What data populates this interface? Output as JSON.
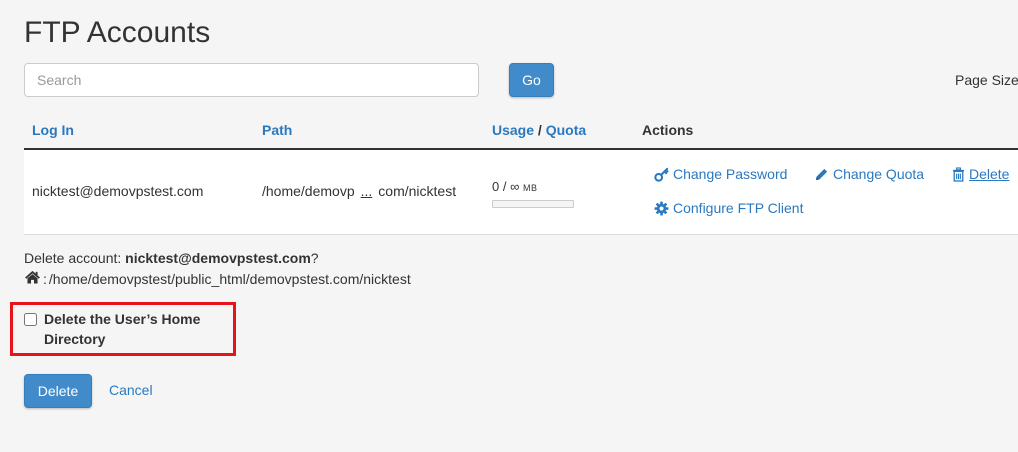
{
  "page": {
    "title": "FTP Accounts"
  },
  "search": {
    "placeholder": "Search",
    "value": "",
    "go_label": "Go",
    "page_size_label": "Page Size"
  },
  "table": {
    "headers": {
      "login": "Log In",
      "path": "Path",
      "usage": "Usage",
      "separator": "/",
      "quota": "Quota",
      "actions": "Actions"
    },
    "rows": [
      {
        "login": "nicktest@demovpstest.com",
        "path_start": "/home/demovp",
        "path_ellipsis": "...",
        "path_end": "com/nicktest",
        "usage_value": "0 / ∞",
        "usage_unit": "MB",
        "usage_fraction": 0,
        "actions": {
          "change_password": "Change Password",
          "change_quota": "Change Quota",
          "delete": "Delete",
          "configure_client": "Configure FTP Client"
        }
      }
    ]
  },
  "confirm": {
    "prefix": "Delete account: ",
    "account": "nicktest@demovpstest.com",
    "suffix": "?",
    "home_prefix": ": ",
    "home_path": "/home/demovpstest/public_html/demovpstest.com/nicktest",
    "checkbox_label": "Delete the User’s Home Directory",
    "checkbox_checked": false,
    "delete_label": "Delete",
    "cancel_label": "Cancel"
  },
  "colors": {
    "link": "#2a79c0",
    "primary_button": "#428bca",
    "highlight_border": "#e8121b"
  }
}
